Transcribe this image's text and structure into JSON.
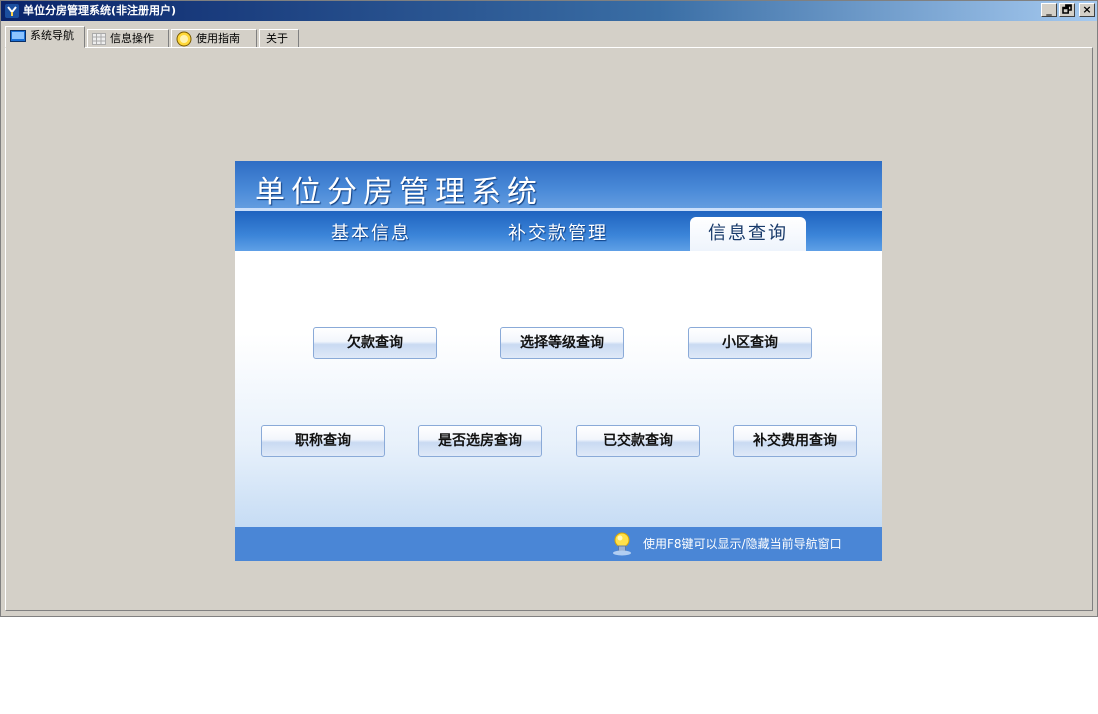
{
  "window": {
    "title": "单位分房管理系统(非注册用户)",
    "controls": [
      "_",
      "🗗",
      "×"
    ]
  },
  "tabs": [
    {
      "label": "系统导航",
      "icon": "monitor-icon",
      "active": true
    },
    {
      "label": "信息操作",
      "icon": "grid-icon",
      "active": false
    },
    {
      "label": "使用指南",
      "icon": "help-icon",
      "active": false
    },
    {
      "label": "关于",
      "icon": "",
      "active": false
    }
  ],
  "panel": {
    "title": "单位分房管理系统",
    "nav": [
      "基本信息",
      "补交款管理",
      "信息查询"
    ],
    "active_nav": "信息查询",
    "buttons_row1": [
      "欠款查询",
      "选择等级查询",
      "小区查询"
    ],
    "buttons_row2": [
      "职称查询",
      "是否选房查询",
      "已交款查询",
      "补交费用查询"
    ],
    "footer_tip": "使用F8键可以显示/隐藏当前导航窗口"
  },
  "colors": {
    "header_blue": "#3b7bd0",
    "footer_blue": "#4a86d6",
    "window_gray": "#d4d0c8"
  }
}
